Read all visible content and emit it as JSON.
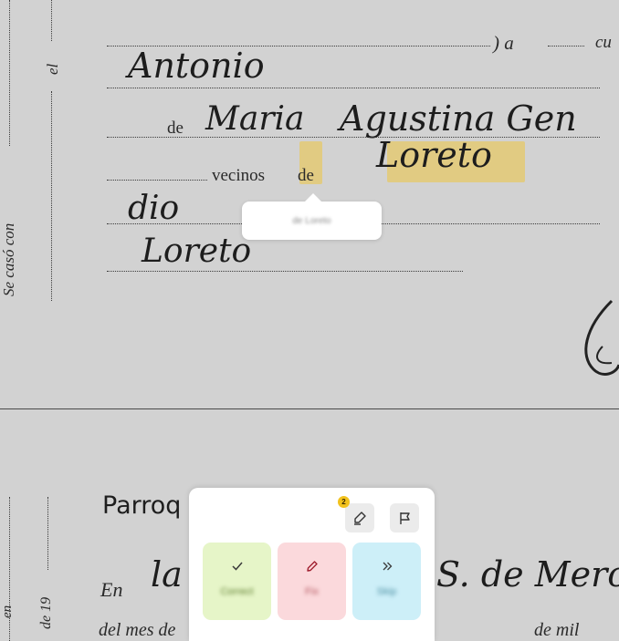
{
  "document": {
    "printed_margin_top": "el",
    "printed_margin_left": "Se casó con",
    "printed_margin_bottom_1": "en",
    "printed_margin_bottom_2": "de 19",
    "printed_de": "de",
    "printed_vecinos": "vecinos",
    "printed_de_2": "de",
    "printed_paren_a": ") a",
    "printed_cu": "cu",
    "printed_parroquia": "Parroq",
    "printed_en": "En",
    "printed_del_mes": "del mes de",
    "printed_de_mil": "de mil",
    "hand_antonio": "Antonio",
    "hand_maria": "Maria",
    "hand_agustina": "Agustina Gen",
    "hand_loreto": "Loreto",
    "hand_dio": "dio",
    "hand_loreto_2": "Loreto",
    "hand_la": "la",
    "hand_mercedes": "S. de Merced"
  },
  "tooltip": {
    "text": "de Loreto"
  },
  "toolbar": {
    "highlighter_badge": "2",
    "highlighter_icon": "highlighter-icon",
    "flag_icon": "flag-icon"
  },
  "actions": [
    {
      "label": "Correct",
      "icon": "check-icon",
      "color": "#e6f5c8",
      "text_color": "#5a7a2a"
    },
    {
      "label": "Fix",
      "icon": "pencil-icon",
      "color": "#fbd9dc",
      "text_color": "#b0505a"
    },
    {
      "label": "Skip",
      "icon": "double-chevron-right-icon",
      "color": "#cdeff8",
      "text_color": "#4a8ea2"
    }
  ]
}
